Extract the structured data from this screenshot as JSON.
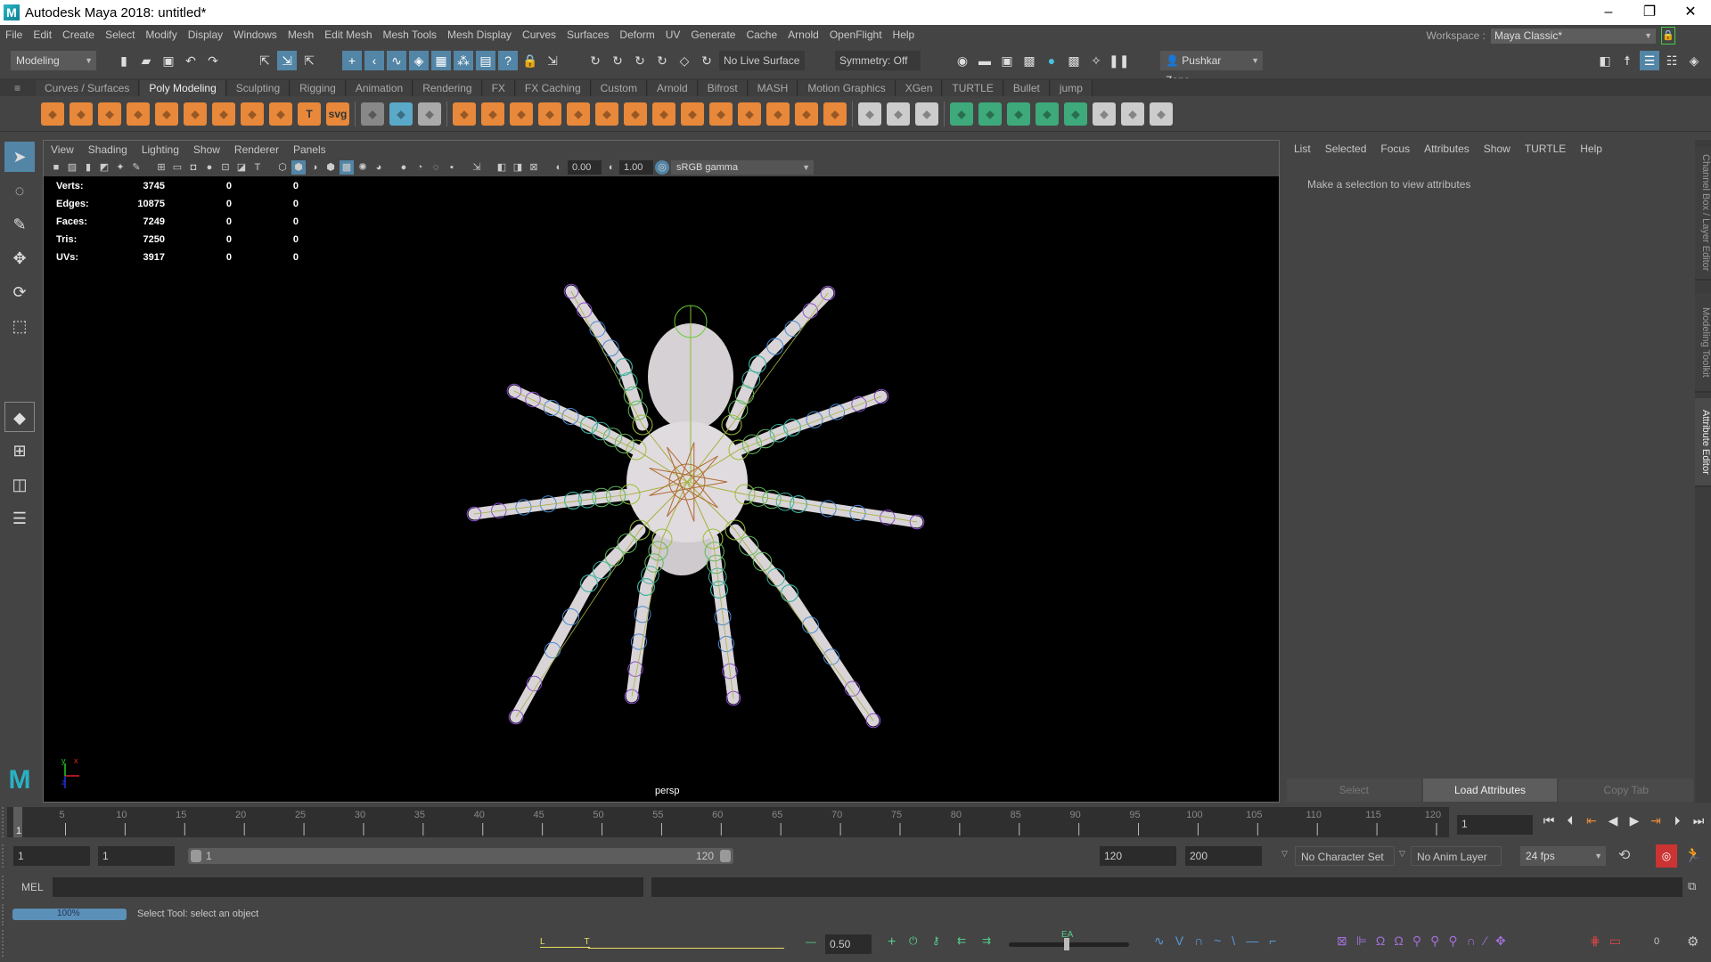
{
  "window": {
    "title": "Autodesk Maya 2018: untitled*",
    "logo": "M",
    "minimize": "–",
    "restore": "❐",
    "close": "✕"
  },
  "menubar": [
    "File",
    "Edit",
    "Create",
    "Select",
    "Modify",
    "Display",
    "Windows",
    "Mesh",
    "Edit Mesh",
    "Mesh Tools",
    "Mesh Display",
    "Curves",
    "Surfaces",
    "Deform",
    "UV",
    "Generate",
    "Cache",
    "Arnold",
    "OpenFlight",
    "Help"
  ],
  "workspace": {
    "label": "Workspace :",
    "value": "Maya Classic*"
  },
  "statusline": {
    "mode": "Modeling",
    "live_surface": "No Live Surface",
    "symmetry": "Symmetry: Off",
    "user": "Pushkar Zope"
  },
  "shelf_tabs": [
    "Curves / Surfaces",
    "Poly Modeling",
    "Sculpting",
    "Rigging",
    "Animation",
    "Rendering",
    "FX",
    "FX Caching",
    "Custom",
    "Arnold",
    "Bifrost",
    "MASH",
    "Motion Graphics",
    "XGen",
    "TURTLE",
    "Bullet",
    "jump"
  ],
  "shelf_active": "Poly Modeling",
  "shelf_icons": [
    {
      "name": "poly-sphere-icon",
      "color": "#e8883a"
    },
    {
      "name": "poly-cube-icon",
      "color": "#e8883a"
    },
    {
      "name": "poly-cylinder-icon",
      "color": "#e8883a"
    },
    {
      "name": "poly-cone-icon",
      "color": "#e8883a"
    },
    {
      "name": "poly-torus-icon",
      "color": "#e8883a"
    },
    {
      "name": "poly-plane-icon",
      "color": "#e8883a"
    },
    {
      "name": "poly-disc-icon",
      "color": "#e8883a"
    },
    {
      "name": "platonic-solid-icon",
      "color": "#e8883a"
    },
    {
      "name": "poly-helix-icon",
      "color": "#e8883a"
    },
    {
      "name": "type-icon",
      "color": "#e8883a",
      "glyph": "T"
    },
    {
      "name": "svg-icon",
      "color": "#e8883a",
      "glyph": "svg"
    },
    {
      "name": "measure-icon",
      "color": "#888"
    },
    {
      "name": "snap-icon",
      "color": "#5aa9c9"
    },
    {
      "name": "sym-icon",
      "color": "#aaa"
    },
    {
      "name": "combine-icon",
      "color": "#e8883a"
    },
    {
      "name": "separate-icon",
      "color": "#e8883a"
    },
    {
      "name": "mirror-icon",
      "color": "#e8883a"
    },
    {
      "name": "smooth-icon",
      "color": "#e8883a"
    },
    {
      "name": "extract-icon",
      "color": "#e8883a"
    },
    {
      "name": "extrude-icon",
      "color": "#e8883a"
    },
    {
      "name": "bridge-icon",
      "color": "#e8883a"
    },
    {
      "name": "bevel-icon",
      "color": "#e8883a"
    },
    {
      "name": "fill-hole-icon",
      "color": "#e8883a"
    },
    {
      "name": "append-icon",
      "color": "#e8883a"
    },
    {
      "name": "wedge-icon",
      "color": "#e8883a"
    },
    {
      "name": "poke-icon",
      "color": "#e8883a"
    },
    {
      "name": "collapse-icon",
      "color": "#e8883a"
    },
    {
      "name": "merge-icon",
      "color": "#e8883a"
    },
    {
      "name": "multicut-icon",
      "color": "#ccc"
    },
    {
      "name": "edge-loop-icon",
      "color": "#ccc"
    },
    {
      "name": "target-weld-icon",
      "color": "#ccc"
    },
    {
      "name": "uv-planar-icon",
      "color": "#3ea97a"
    },
    {
      "name": "uv-cylindrical-icon",
      "color": "#3ea97a"
    },
    {
      "name": "uv-spherical-icon",
      "color": "#3ea97a"
    },
    {
      "name": "uv-auto-icon",
      "color": "#3ea97a"
    },
    {
      "name": "uv-contour-icon",
      "color": "#3ea97a"
    },
    {
      "name": "uv-editor-icon",
      "color": "#ccc"
    },
    {
      "name": "uv-unfold-icon",
      "color": "#ccc"
    },
    {
      "name": "uv-cut-icon",
      "color": "#ccc"
    }
  ],
  "panel": {
    "menu": [
      "View",
      "Shading",
      "Lighting",
      "Show",
      "Renderer",
      "Panels"
    ],
    "exposure": "0.00",
    "gamma": "1.00",
    "color_space": "sRGB gamma",
    "camera": "persp"
  },
  "hud": [
    {
      "label": "Verts:",
      "a": "3745",
      "b": "0",
      "c": "0"
    },
    {
      "label": "Edges:",
      "a": "10875",
      "b": "0",
      "c": "0"
    },
    {
      "label": "Faces:",
      "a": "7249",
      "b": "0",
      "c": "0"
    },
    {
      "label": "Tris:",
      "a": "7250",
      "b": "0",
      "c": "0"
    },
    {
      "label": "UVs:",
      "a": "3917",
      "b": "0",
      "c": "0"
    }
  ],
  "axes": {
    "y": "y",
    "x": "x",
    "z": "z"
  },
  "attribute_editor": {
    "menu": [
      "List",
      "Selected",
      "Focus",
      "Attributes",
      "Show",
      "TURTLE",
      "Help"
    ],
    "message": "Make a selection to view attributes",
    "buttons": [
      "Select",
      "Load Attributes",
      "Copy Tab"
    ]
  },
  "side_tabs": [
    "Channel Box / Layer Editor",
    "Modeling Toolkit",
    "Attribute Editor"
  ],
  "timeline": {
    "start": 1,
    "end": 120,
    "current": 1,
    "labels": [
      5,
      10,
      15,
      20,
      25,
      30,
      35,
      40,
      45,
      50,
      55,
      60,
      65,
      70,
      75,
      80,
      85,
      90,
      95,
      100,
      105,
      110,
      115,
      120
    ],
    "current_label": "1",
    "current_frame_field": "1"
  },
  "range": {
    "start": "1",
    "playback_start": "1",
    "slider_start": "1",
    "slider_end": "120",
    "playback_end": "120",
    "end": "200",
    "character_set": "No Character Set",
    "anim_layer": "No Anim Layer",
    "fps": "24 fps"
  },
  "command_line": {
    "label": "MEL",
    "value": "",
    "output": ""
  },
  "help_line": {
    "progress": 100,
    "progress_label": "100%",
    "text": "Select Tool: select an object"
  },
  "anim_toolbar": {
    "weight": "0.50",
    "ea": "EA",
    "count": "0",
    "timeline_marks": "L                T"
  }
}
